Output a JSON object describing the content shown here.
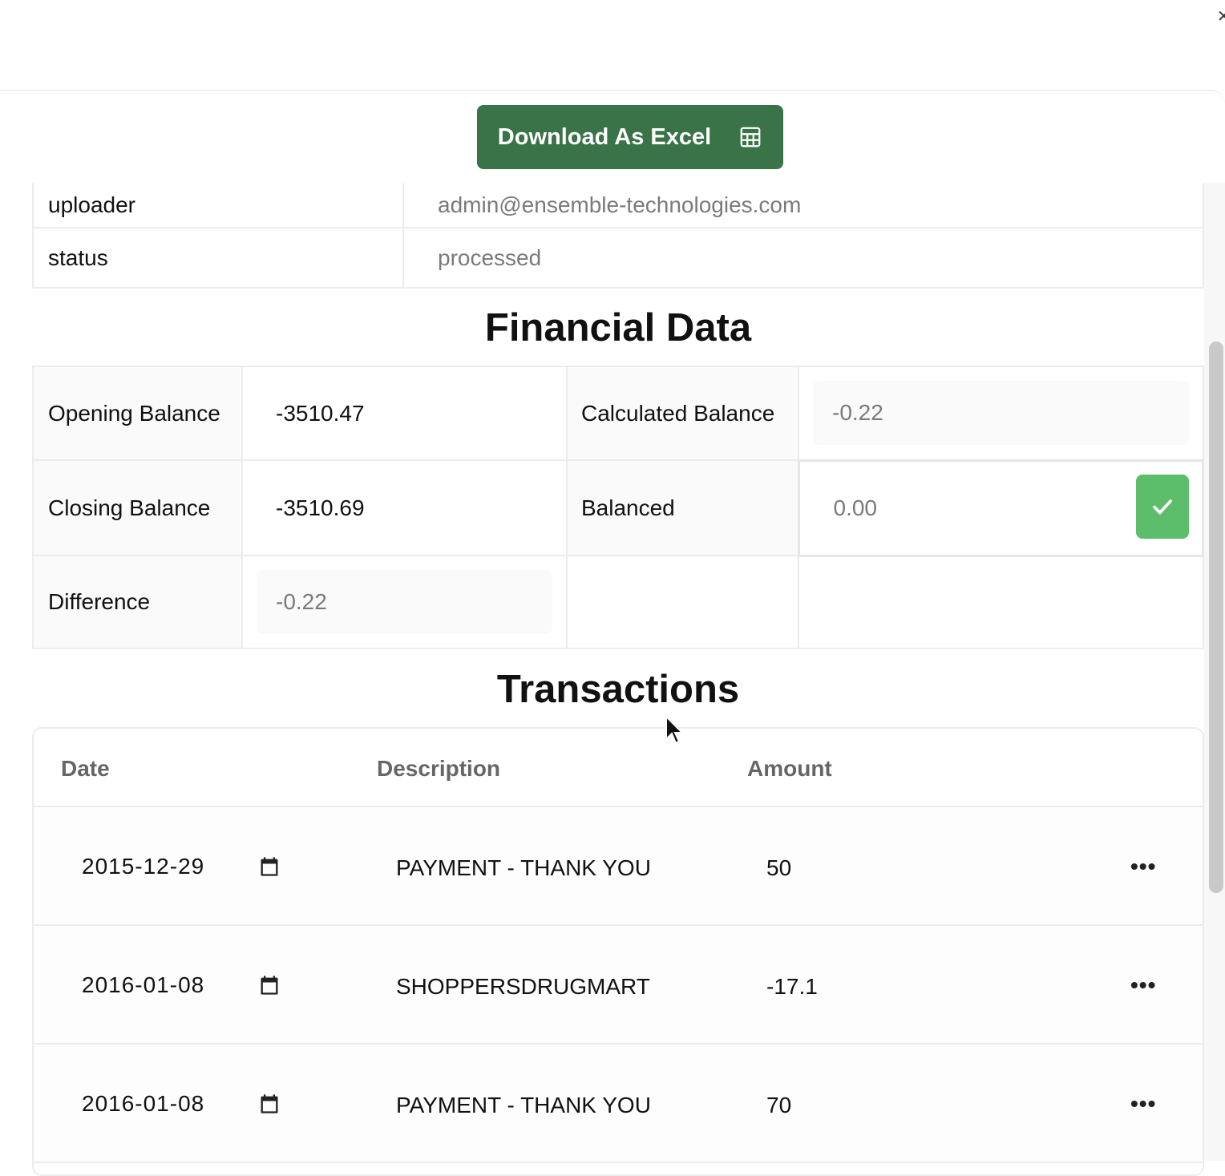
{
  "toolbar": {
    "download_label": "Download As Excel"
  },
  "meta": [
    {
      "key": "uploader",
      "value": "admin@ensemble-technologies.com"
    },
    {
      "key": "status",
      "value": "processed"
    }
  ],
  "financial": {
    "title": "Financial Data",
    "opening_label": "Opening Balance",
    "opening_value": "-3510.47",
    "calculated_label": "Calculated Balance",
    "calculated_value": "-0.22",
    "closing_label": "Closing Balance",
    "closing_value": "-3510.69",
    "balanced_label": "Balanced",
    "balanced_value": "0.00",
    "difference_label": "Difference",
    "difference_value": "-0.22"
  },
  "transactions": {
    "title": "Transactions",
    "columns": [
      "Date",
      "Description",
      "Amount"
    ],
    "rows": [
      {
        "date": "2015-12-29",
        "description": "PAYMENT - THANK YOU",
        "amount": "50"
      },
      {
        "date": "2016-01-08",
        "description": "SHOPPERSDRUGMART(",
        "amount": "-17.1"
      },
      {
        "date": "2016-01-08",
        "description": "PAYMENT - THANK YOU",
        "amount": "70"
      }
    ],
    "more_glyph": "•••"
  },
  "icons": {
    "download": "table-grid-icon",
    "balanced_ok": "check-icon",
    "date_picker": "calendar-icon",
    "row_menu": "more-horizontal-icon"
  },
  "colors": {
    "download_button": "#3a7347",
    "balanced_ok": "#5cbe6a"
  }
}
